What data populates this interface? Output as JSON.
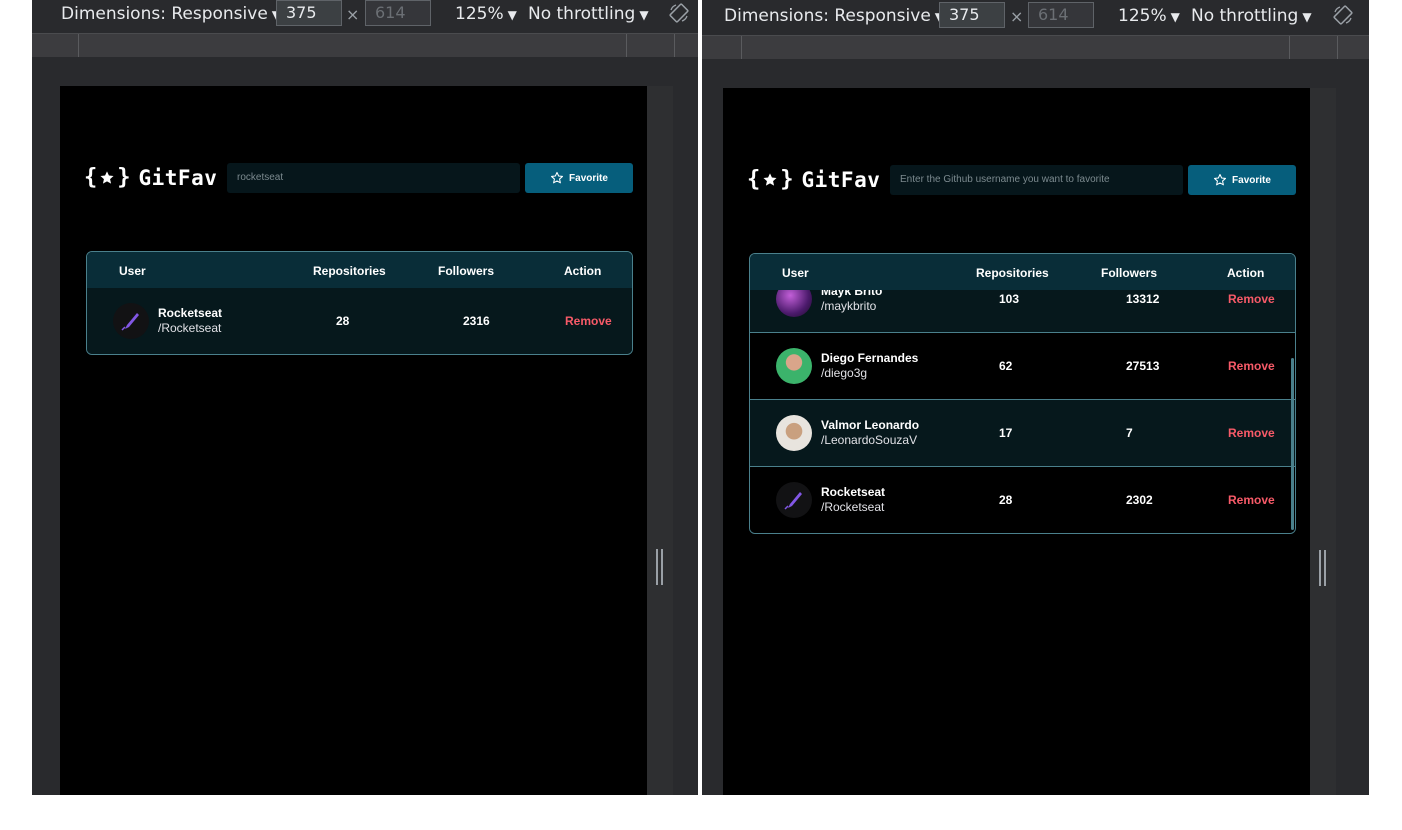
{
  "devtools": {
    "dimensions_label": "Dimensions: Responsive",
    "width_value": "375",
    "height_value": "614",
    "times": "×",
    "zoom": "125%",
    "throttling": "No throttling",
    "caret": "▼",
    "rotate_icon": "rotate-icon"
  },
  "app": {
    "logo_left": "{",
    "logo_right": "}",
    "logo_text": "GitFav",
    "favorite_label": "Favorite",
    "headers": {
      "user": "User",
      "repositories": "Repositories",
      "followers": "Followers",
      "action": "Action"
    }
  },
  "left": {
    "search_value": "rocketseat",
    "rows": [
      {
        "name": "Rocketseat",
        "login": "/Rocketseat",
        "repositories": "28",
        "followers": "2316",
        "action": "Remove"
      }
    ]
  },
  "right": {
    "search_placeholder": "Enter the Github username you want to favorite",
    "rows": [
      {
        "name": "Mayk Brito",
        "login": "/maykbrito",
        "repositories": "103",
        "followers": "13312",
        "action": "Remove"
      },
      {
        "name": "Diego Fernandes",
        "login": "/diego3g",
        "repositories": "62",
        "followers": "27513",
        "action": "Remove"
      },
      {
        "name": "Valmor Leonardo",
        "login": "/LeonardoSouzaV",
        "repositories": "17",
        "followers": "7",
        "action": "Remove"
      },
      {
        "name": "Rocketseat",
        "login": "/Rocketseat",
        "repositories": "28",
        "followers": "2302",
        "action": "Remove"
      }
    ]
  },
  "colors": {
    "accent_button": "#065e7c",
    "remove": "#f75a68",
    "table_header": "#092d38",
    "border": "#4a808c"
  }
}
